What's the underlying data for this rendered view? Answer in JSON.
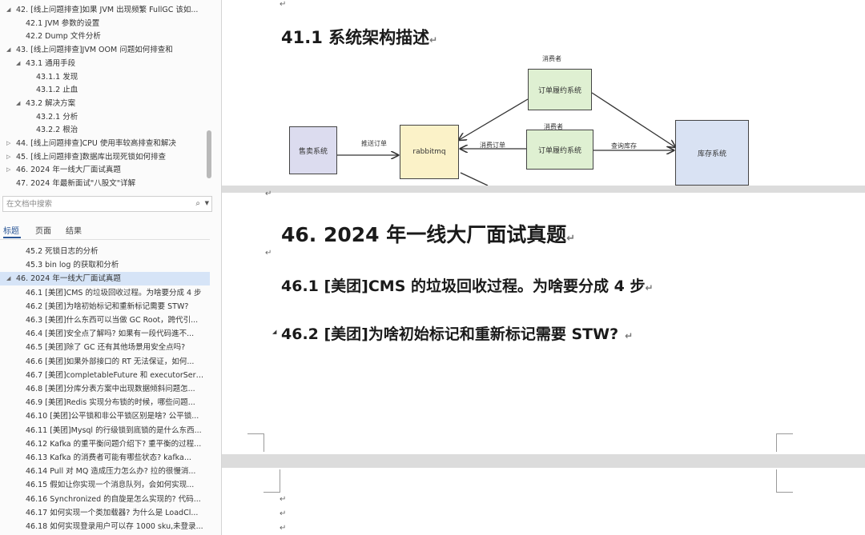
{
  "nav": {
    "toc_top": [
      {
        "level": 1,
        "arrow": "expanded",
        "text": "42.  [线上问题排查]如果 JVM 出现频繁 FullGC 该如..."
      },
      {
        "level": 2,
        "arrow": "",
        "text": "42.1 JVM 参数的设置"
      },
      {
        "level": 2,
        "arrow": "",
        "text": "42.2 Dump 文件分析"
      },
      {
        "level": 1,
        "arrow": "expanded",
        "text": "43.  [线上问题排查]JVM OOM 问题如何排查和"
      },
      {
        "level": 2,
        "arrow": "expanded",
        "text": "43.1 通用手段"
      },
      {
        "level": 3,
        "arrow": "",
        "text": "43.1.1 发现"
      },
      {
        "level": 3,
        "arrow": "",
        "text": "43.1.2 止血"
      },
      {
        "level": 2,
        "arrow": "expanded",
        "text": "43.2 解决方案"
      },
      {
        "level": 3,
        "arrow": "",
        "text": "43.2.1 分析"
      },
      {
        "level": 3,
        "arrow": "",
        "text": "43.2.2 根治"
      },
      {
        "level": 1,
        "arrow": "collapsed",
        "text": "44.  [线上问题排查]CPU 使用率较高排查和解决"
      },
      {
        "level": 1,
        "arrow": "collapsed",
        "text": "45.  [线上问题排查]数据库出现死锁如何排查"
      },
      {
        "level": 1,
        "arrow": "collapsed",
        "text": "46.  2024 年一线大厂面试真题"
      },
      {
        "level": 1,
        "arrow": "",
        "text": "47.  2024 年最新面试\"八股文\"详解"
      }
    ],
    "search_placeholder": "在文档中搜索",
    "search_icon": "search-icon",
    "tabs": [
      "标题",
      "页面",
      "结果"
    ],
    "toc_bottom": [
      {
        "level": 2,
        "arrow": "",
        "selected": false,
        "text": "45.2 死锁日志的分析"
      },
      {
        "level": 2,
        "arrow": "",
        "selected": false,
        "text": "45.3 bin log 的获取和分析"
      },
      {
        "level": 1,
        "arrow": "expanded",
        "selected": true,
        "text": "46.  2024 年一线大厂面试真题"
      },
      {
        "level": 2,
        "arrow": "",
        "selected": false,
        "text": "46.1 [美团]CMS 的垃圾回收过程。为啥要分成 4 步"
      },
      {
        "level": 2,
        "arrow": "",
        "selected": false,
        "text": "46.2 [美团]为啥初始标记和重新标记需要 STW?"
      },
      {
        "level": 2,
        "arrow": "",
        "selected": false,
        "text": "46.3 [美团]什么东西可以当做 GC Root，跨代引..."
      },
      {
        "level": 2,
        "arrow": "",
        "selected": false,
        "text": "46.4 [美团]安全点了解吗? 如果有一段代码進不..."
      },
      {
        "level": 2,
        "arrow": "",
        "selected": false,
        "text": "46.5 [美团]除了 GC 还有其他场景用安全点吗?"
      },
      {
        "level": 2,
        "arrow": "",
        "selected": false,
        "text": "46.6 [美团]如果外部接口的 RT 无法保证，如何..."
      },
      {
        "level": 2,
        "arrow": "",
        "selected": false,
        "text": "46.7 [美团]completableFuture 和 executorServ..."
      },
      {
        "level": 2,
        "arrow": "",
        "selected": false,
        "text": "46.8 [美团]分库分表方案中出现数据倾斜问题怎..."
      },
      {
        "level": 2,
        "arrow": "",
        "selected": false,
        "text": "46.9 [美团]Redis 实现分布锁的时候，哪些问题..."
      },
      {
        "level": 2,
        "arrow": "",
        "selected": false,
        "text": "46.10 [美团]公平锁和非公平锁区别是啥? 公平锁..."
      },
      {
        "level": 2,
        "arrow": "",
        "selected": false,
        "text": "46.11 [美团]Mysql 的行级锁到底锁的是什么东西..."
      },
      {
        "level": 2,
        "arrow": "",
        "selected": false,
        "text": "46.12 Kafka 的重平衡问题介绍下? 重平衡的过程..."
      },
      {
        "level": 2,
        "arrow": "",
        "selected": false,
        "text": "46.13 Kafka 的消费者可能有哪些状态? kafka..."
      },
      {
        "level": 2,
        "arrow": "",
        "selected": false,
        "text": "46.14 Pull 对 MQ 造成压力怎么办? 拉的很慢消..."
      },
      {
        "level": 2,
        "arrow": "",
        "selected": false,
        "text": "46.15 假如让你实现一个消息队列，会如何实现..."
      },
      {
        "level": 2,
        "arrow": "",
        "selected": false,
        "text": "46.16 Synchronized 的自旋是怎么实现的? 代码..."
      },
      {
        "level": 2,
        "arrow": "",
        "selected": false,
        "text": "46.17 如何实现一个类加载器? 为什么是 LoadCl..."
      },
      {
        "level": 2,
        "arrow": "",
        "selected": false,
        "text": "46.18 如何实现登录用户可以存 1000 sku,未登录..."
      },
      {
        "level": 2,
        "arrow": "",
        "selected": false,
        "text": "46.19 如果需要实现一个通用的功能，你会考虑..."
      }
    ]
  },
  "doc": {
    "paragraph_mark": "↵",
    "p1_heading": "41.1  系统架构描述",
    "diagram": {
      "box_left": "售卖系统",
      "box_rabbit": "rabbitmq",
      "box_order_top": "订单履约系统",
      "box_order_mid": "订单履约系统",
      "box_stock": "库存系统",
      "label_consumer_top": "消费者",
      "label_consumer_mid": "消费者",
      "label_push": "推送订单",
      "label_consume": "消费订单",
      "label_query": "查询库存"
    },
    "h46": "46.  2024 年一线大厂面试真题",
    "h46_1": "46.1  [美团]CMS 的垃圾回收过程。为啥要分成 4 步",
    "h46_2": "46.2  [美团]为啥初始标记和重新标记需要 STW?"
  }
}
